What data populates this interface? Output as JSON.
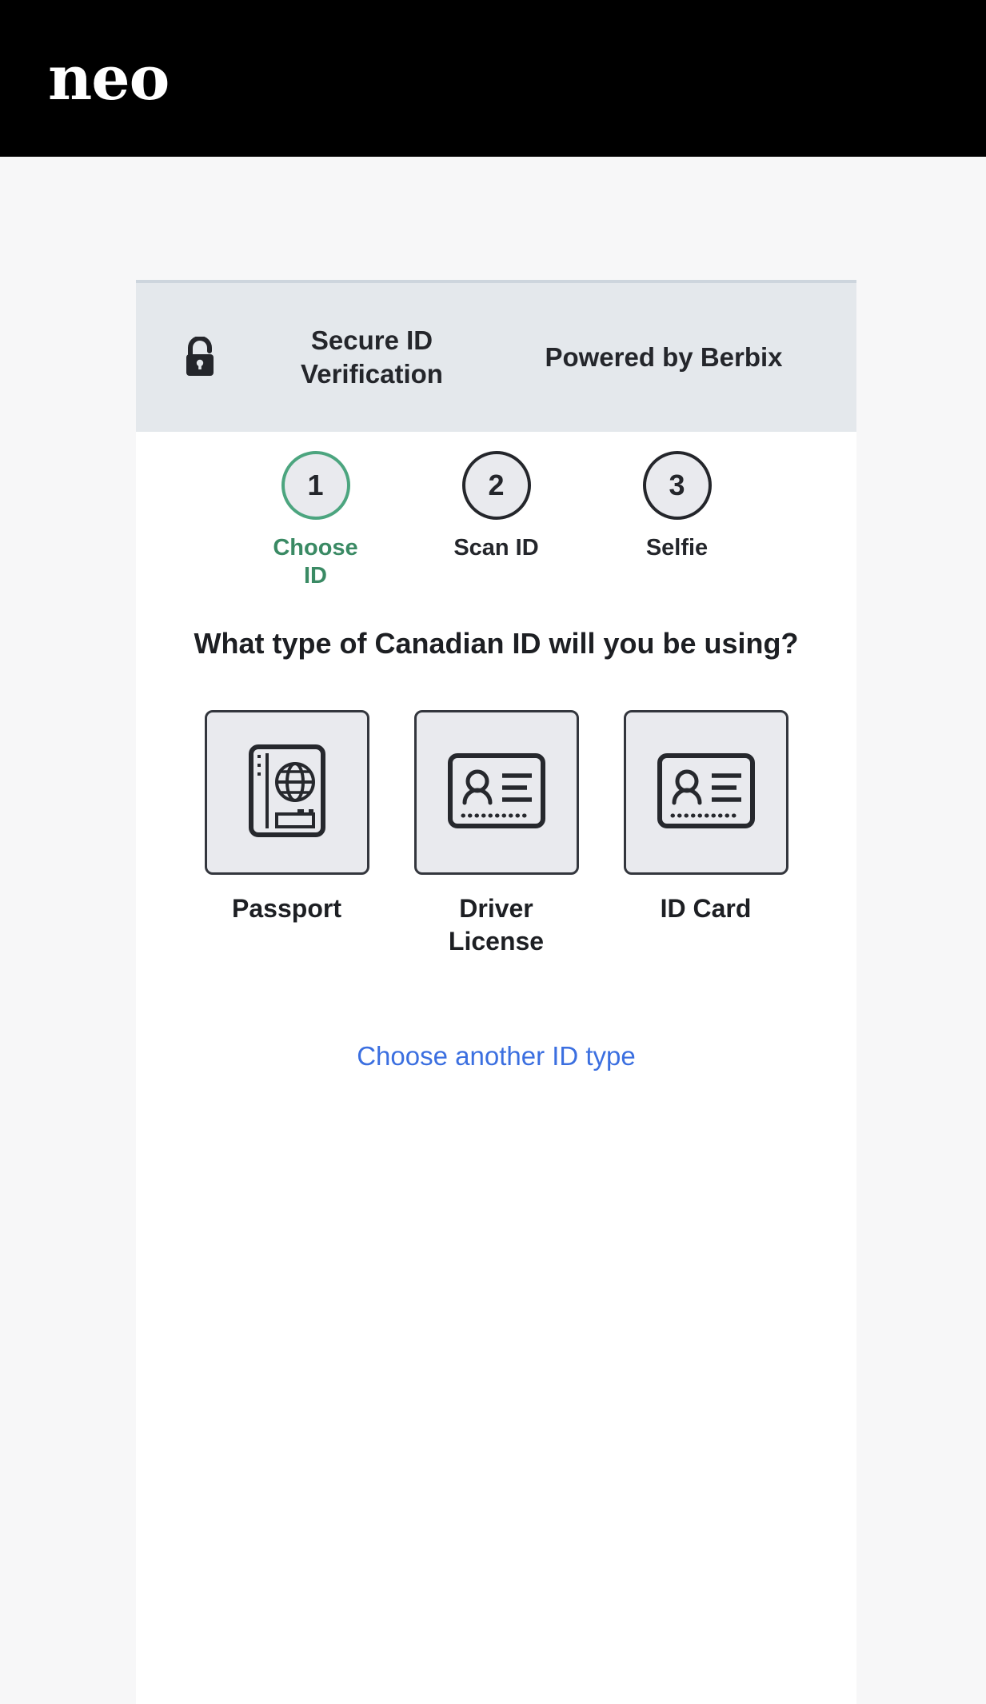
{
  "brand": {
    "logo_text": "neo",
    "logo_color": "#ffffff",
    "header_background": "#000000"
  },
  "banner": {
    "lock_icon": "lock-icon",
    "title": "Secure ID Verification",
    "powered_by": "Powered by Berbix",
    "background": "#e4e8ec"
  },
  "steps": [
    {
      "number": "1",
      "label": "Choose ID",
      "active": true,
      "accent": "#4ca57f"
    },
    {
      "number": "2",
      "label": "Scan ID",
      "active": false,
      "accent": "#24262b"
    },
    {
      "number": "3",
      "label": "Selfie",
      "active": false,
      "accent": "#24262b"
    }
  ],
  "main": {
    "question": "What type of Canadian ID will you be using?",
    "id_options": [
      {
        "label": "Passport",
        "icon": "passport-icon"
      },
      {
        "label": "Driver License",
        "icon": "id-card-icon"
      },
      {
        "label": "ID Card",
        "icon": "id-card-icon"
      }
    ],
    "alt_link": "Choose another ID type",
    "link_color": "#3b6fe0"
  }
}
